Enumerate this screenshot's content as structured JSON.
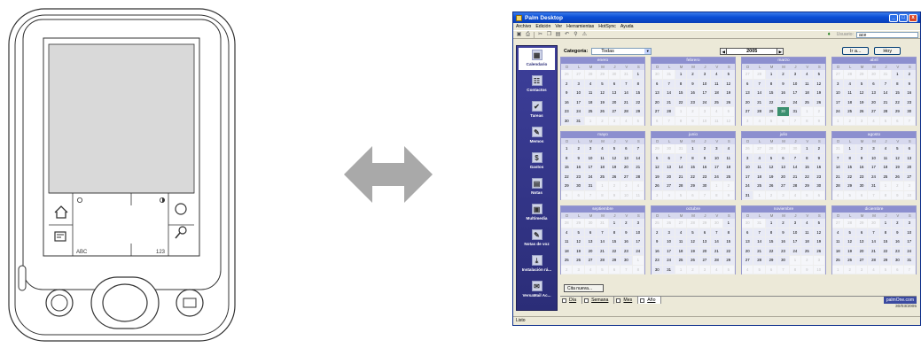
{
  "window": {
    "title": "Palm Desktop",
    "menu": [
      "Archivo",
      "Edición",
      "Ver",
      "Herramientas",
      "HotSync",
      "Ayuda"
    ],
    "user_label": "Usuario:",
    "user_value": "ace",
    "status": "Listo",
    "brand": "palmOne.com",
    "date": "30/03/2005"
  },
  "sidebar": {
    "items": [
      {
        "label": "Calendario",
        "icon": "calendar-icon"
      },
      {
        "label": "Contactos",
        "icon": "contacts-icon"
      },
      {
        "label": "Tareas",
        "icon": "tasks-icon"
      },
      {
        "label": "Memos",
        "icon": "memos-icon"
      },
      {
        "label": "Gastos",
        "icon": "expenses-icon"
      },
      {
        "label": "Notas",
        "icon": "notes-icon"
      },
      {
        "label": "Multimedia",
        "icon": "multimedia-icon"
      },
      {
        "label": "Notas de voz",
        "icon": "voice-notes-icon"
      },
      {
        "label": "Instalación rá...",
        "icon": "quick-install-icon"
      },
      {
        "label": "VersaMail Ac...",
        "icon": "versamail-icon"
      }
    ]
  },
  "controls": {
    "category_label": "Categoría:",
    "category_value": "Todas",
    "year": "2005",
    "goto": "Ir a...",
    "today": "Hoy",
    "new_appt": "Cita nueva..."
  },
  "view_tabs": [
    "Día",
    "Semana",
    "Mes",
    "Año"
  ],
  "weekdays": [
    "D",
    "L",
    "M",
    "M",
    "J",
    "V",
    "S"
  ],
  "months": [
    {
      "name": "enero",
      "start": 6,
      "days": 31,
      "prev": 31
    },
    {
      "name": "febrero",
      "start": 2,
      "days": 28,
      "prev": 31
    },
    {
      "name": "marzo",
      "start": 2,
      "days": 31,
      "prev": 28,
      "today": 30
    },
    {
      "name": "abril",
      "start": 5,
      "days": 30,
      "prev": 31
    },
    {
      "name": "mayo",
      "start": 0,
      "days": 31,
      "prev": 30
    },
    {
      "name": "junio",
      "start": 3,
      "days": 30,
      "prev": 31
    },
    {
      "name": "julio",
      "start": 5,
      "days": 31,
      "prev": 30
    },
    {
      "name": "agosto",
      "start": 1,
      "days": 31,
      "prev": 31
    },
    {
      "name": "septiembre",
      "start": 4,
      "days": 30,
      "prev": 31
    },
    {
      "name": "octubre",
      "start": 6,
      "days": 31,
      "prev": 30
    },
    {
      "name": "noviembre",
      "start": 2,
      "days": 30,
      "prev": 31
    },
    {
      "name": "diciembre",
      "start": 4,
      "days": 31,
      "prev": 30
    }
  ],
  "device": {
    "graffiti_left": "ABC",
    "graffiti_right": "123"
  }
}
